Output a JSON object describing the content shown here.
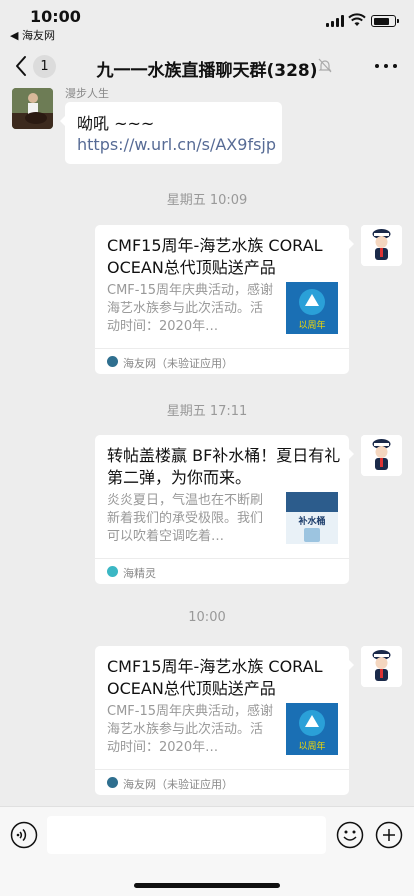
{
  "status_bar": {
    "time": "10:00",
    "back_app": "◀ 海友网",
    "battery_level": 0.8
  },
  "nav": {
    "badge": "1",
    "title": "九一一水族直播聊天群(328)",
    "icons": {
      "back": "chevron-left-icon",
      "mute": "bell-off-icon",
      "more": "more-dots-icon"
    }
  },
  "messages": {
    "first": {
      "sender": "漫步人生",
      "text": "呦吼 ~~~",
      "link": "https://w.url.cn/s/AX9fsjp"
    },
    "time1": "星期五 10:09",
    "card1": {
      "title": "CMF15周年-海艺水族 CORAL OCEAN总代顶贴送产品",
      "desc": "CMF-15周年庆典活动，感谢海艺水族参与此次活动。活动时间：2020年…",
      "source": "海友网（未验证应用）",
      "thumb_text": "以周年"
    },
    "time2": "星期五 17:11",
    "card2": {
      "title": "转帖盖楼赢 BF补水桶！夏日有礼第二弹，为你而来。",
      "desc": "炎炎夏日，气温也在不断刷新着我们的承受极限。我们可以吹着空调吃着…",
      "source": "海精灵",
      "thumb_text": "补水桶"
    },
    "time3": "10:00",
    "card3": {
      "title": "CMF15周年-海艺水族 CORAL OCEAN总代顶贴送产品",
      "desc": "CMF-15周年庆典活动，感谢海艺水族参与此次活动。活动时间：2020年…",
      "source": "海友网（未验证应用）",
      "thumb_text": "以周年"
    }
  },
  "input": {
    "value": "",
    "icons": {
      "voice": "voice-icon",
      "emoji": "emoji-icon",
      "plus": "plus-icon"
    }
  },
  "colors": {
    "link": "#576b95",
    "background": "#ededed"
  }
}
